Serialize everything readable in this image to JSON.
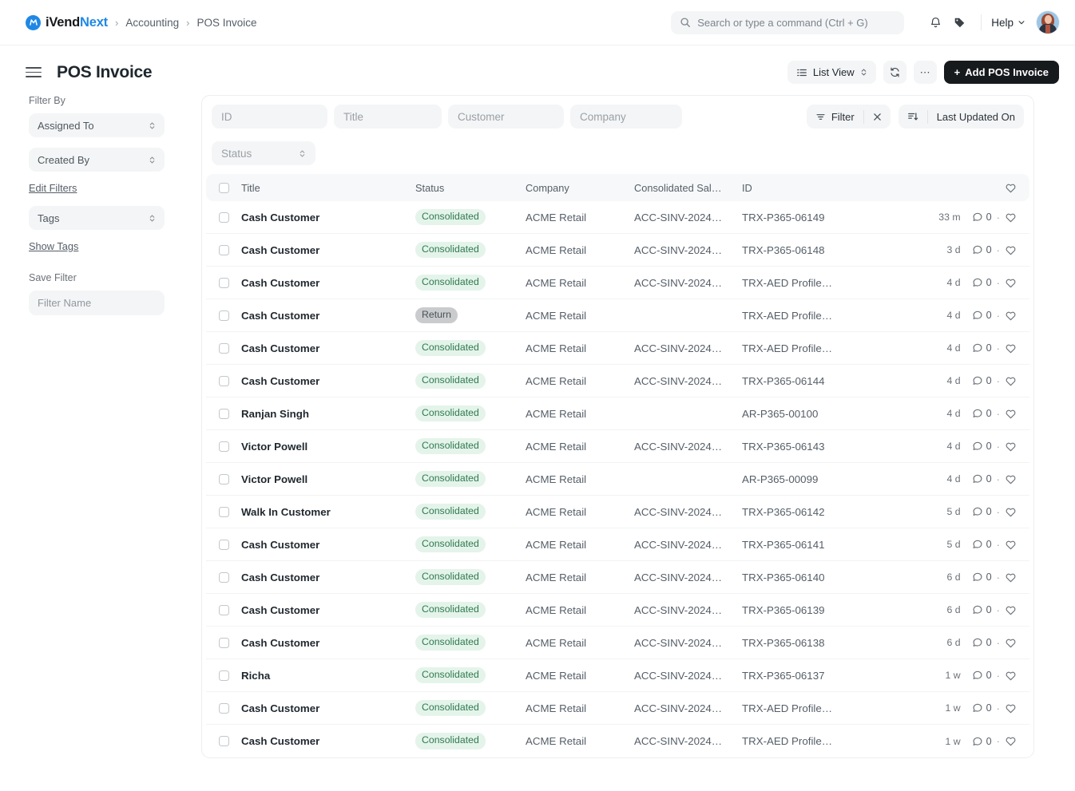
{
  "navbar": {
    "brand_first": "iVend",
    "brand_second": "Next",
    "brand_mark": "M",
    "breadcrumb": [
      "Accounting",
      "POS Invoice"
    ],
    "search_placeholder": "Search or type a command (Ctrl + G)",
    "help_label": "Help",
    "icons": [
      "search-icon",
      "bell-icon",
      "tag-icon",
      "chevron-down-icon",
      "avatar"
    ]
  },
  "pagehead": {
    "title": "POS Invoice",
    "list_view_label": "List View",
    "refresh_icon": "refresh-icon",
    "more_label": "⋯",
    "add_label": "Add POS Invoice",
    "add_prefix": "+"
  },
  "sidebar": {
    "filter_by_label": "Filter By",
    "assigned_to": "Assigned To",
    "created_by": "Created By",
    "edit_filters": "Edit Filters",
    "tags": "Tags",
    "show_tags": "Show Tags",
    "save_filter_label": "Save Filter",
    "filter_name_placeholder": "Filter Name"
  },
  "filters": {
    "id_placeholder": "ID",
    "title_placeholder": "Title",
    "customer_placeholder": "Customer",
    "company_placeholder": "Company",
    "status_placeholder": "Status",
    "filter_label": "Filter",
    "clear_label": "×",
    "sort_label": "Last Updated On"
  },
  "table": {
    "columns": [
      "Title",
      "Status",
      "Company",
      "Consolidated Sal…",
      "ID"
    ],
    "rows": [
      {
        "title": "Cash Customer",
        "status": "Consolidated",
        "status_kind": "green",
        "company": "ACME Retail",
        "consolidated": "ACC-SINV-2024…",
        "id": "TRX-P365-06149",
        "time": "33 m",
        "comments": "0"
      },
      {
        "title": "Cash Customer",
        "status": "Consolidated",
        "status_kind": "green",
        "company": "ACME Retail",
        "consolidated": "ACC-SINV-2024…",
        "id": "TRX-P365-06148",
        "time": "3 d",
        "comments": "0"
      },
      {
        "title": "Cash Customer",
        "status": "Consolidated",
        "status_kind": "green",
        "company": "ACME Retail",
        "consolidated": "ACC-SINV-2024…",
        "id": "TRX-AED Profile…",
        "time": "4 d",
        "comments": "0"
      },
      {
        "title": "Cash Customer",
        "status": "Return",
        "status_kind": "gray",
        "company": "ACME Retail",
        "consolidated": "",
        "id": "TRX-AED Profile…",
        "time": "4 d",
        "comments": "0"
      },
      {
        "title": "Cash Customer",
        "status": "Consolidated",
        "status_kind": "green",
        "company": "ACME Retail",
        "consolidated": "ACC-SINV-2024…",
        "id": "TRX-AED Profile…",
        "time": "4 d",
        "comments": "0"
      },
      {
        "title": "Cash Customer",
        "status": "Consolidated",
        "status_kind": "green",
        "company": "ACME Retail",
        "consolidated": "ACC-SINV-2024…",
        "id": "TRX-P365-06144",
        "time": "4 d",
        "comments": "0"
      },
      {
        "title": "Ranjan Singh",
        "status": "Consolidated",
        "status_kind": "green",
        "company": "ACME Retail",
        "consolidated": "",
        "id": "AR-P365-00100",
        "time": "4 d",
        "comments": "0"
      },
      {
        "title": "Victor Powell",
        "status": "Consolidated",
        "status_kind": "green",
        "company": "ACME Retail",
        "consolidated": "ACC-SINV-2024…",
        "id": "TRX-P365-06143",
        "time": "4 d",
        "comments": "0"
      },
      {
        "title": "Victor Powell",
        "status": "Consolidated",
        "status_kind": "green",
        "company": "ACME Retail",
        "consolidated": "",
        "id": "AR-P365-00099",
        "time": "4 d",
        "comments": "0"
      },
      {
        "title": "Walk In Customer",
        "status": "Consolidated",
        "status_kind": "green",
        "company": "ACME Retail",
        "consolidated": "ACC-SINV-2024…",
        "id": "TRX-P365-06142",
        "time": "5 d",
        "comments": "0"
      },
      {
        "title": "Cash Customer",
        "status": "Consolidated",
        "status_kind": "green",
        "company": "ACME Retail",
        "consolidated": "ACC-SINV-2024…",
        "id": "TRX-P365-06141",
        "time": "5 d",
        "comments": "0"
      },
      {
        "title": "Cash Customer",
        "status": "Consolidated",
        "status_kind": "green",
        "company": "ACME Retail",
        "consolidated": "ACC-SINV-2024…",
        "id": "TRX-P365-06140",
        "time": "6 d",
        "comments": "0"
      },
      {
        "title": "Cash Customer",
        "status": "Consolidated",
        "status_kind": "green",
        "company": "ACME Retail",
        "consolidated": "ACC-SINV-2024…",
        "id": "TRX-P365-06139",
        "time": "6 d",
        "comments": "0"
      },
      {
        "title": "Cash Customer",
        "status": "Consolidated",
        "status_kind": "green",
        "company": "ACME Retail",
        "consolidated": "ACC-SINV-2024…",
        "id": "TRX-P365-06138",
        "time": "6 d",
        "comments": "0"
      },
      {
        "title": "Richa",
        "status": "Consolidated",
        "status_kind": "green",
        "company": "ACME Retail",
        "consolidated": "ACC-SINV-2024…",
        "id": "TRX-P365-06137",
        "time": "1 w",
        "comments": "0"
      },
      {
        "title": "Cash Customer",
        "status": "Consolidated",
        "status_kind": "green",
        "company": "ACME Retail",
        "consolidated": "ACC-SINV-2024…",
        "id": "TRX-AED Profile…",
        "time": "1 w",
        "comments": "0"
      },
      {
        "title": "Cash Customer",
        "status": "Consolidated",
        "status_kind": "green",
        "company": "ACME Retail",
        "consolidated": "ACC-SINV-2024…",
        "id": "TRX-AED Profile…",
        "time": "1 w",
        "comments": "0"
      }
    ]
  },
  "colors": {
    "brand_blue": "#1f88e5",
    "badge_green_bg": "#e4f4ea",
    "badge_green_fg": "#30794f",
    "badge_gray_bg": "#c9cbcd",
    "primary_button_bg": "#171a1d"
  }
}
